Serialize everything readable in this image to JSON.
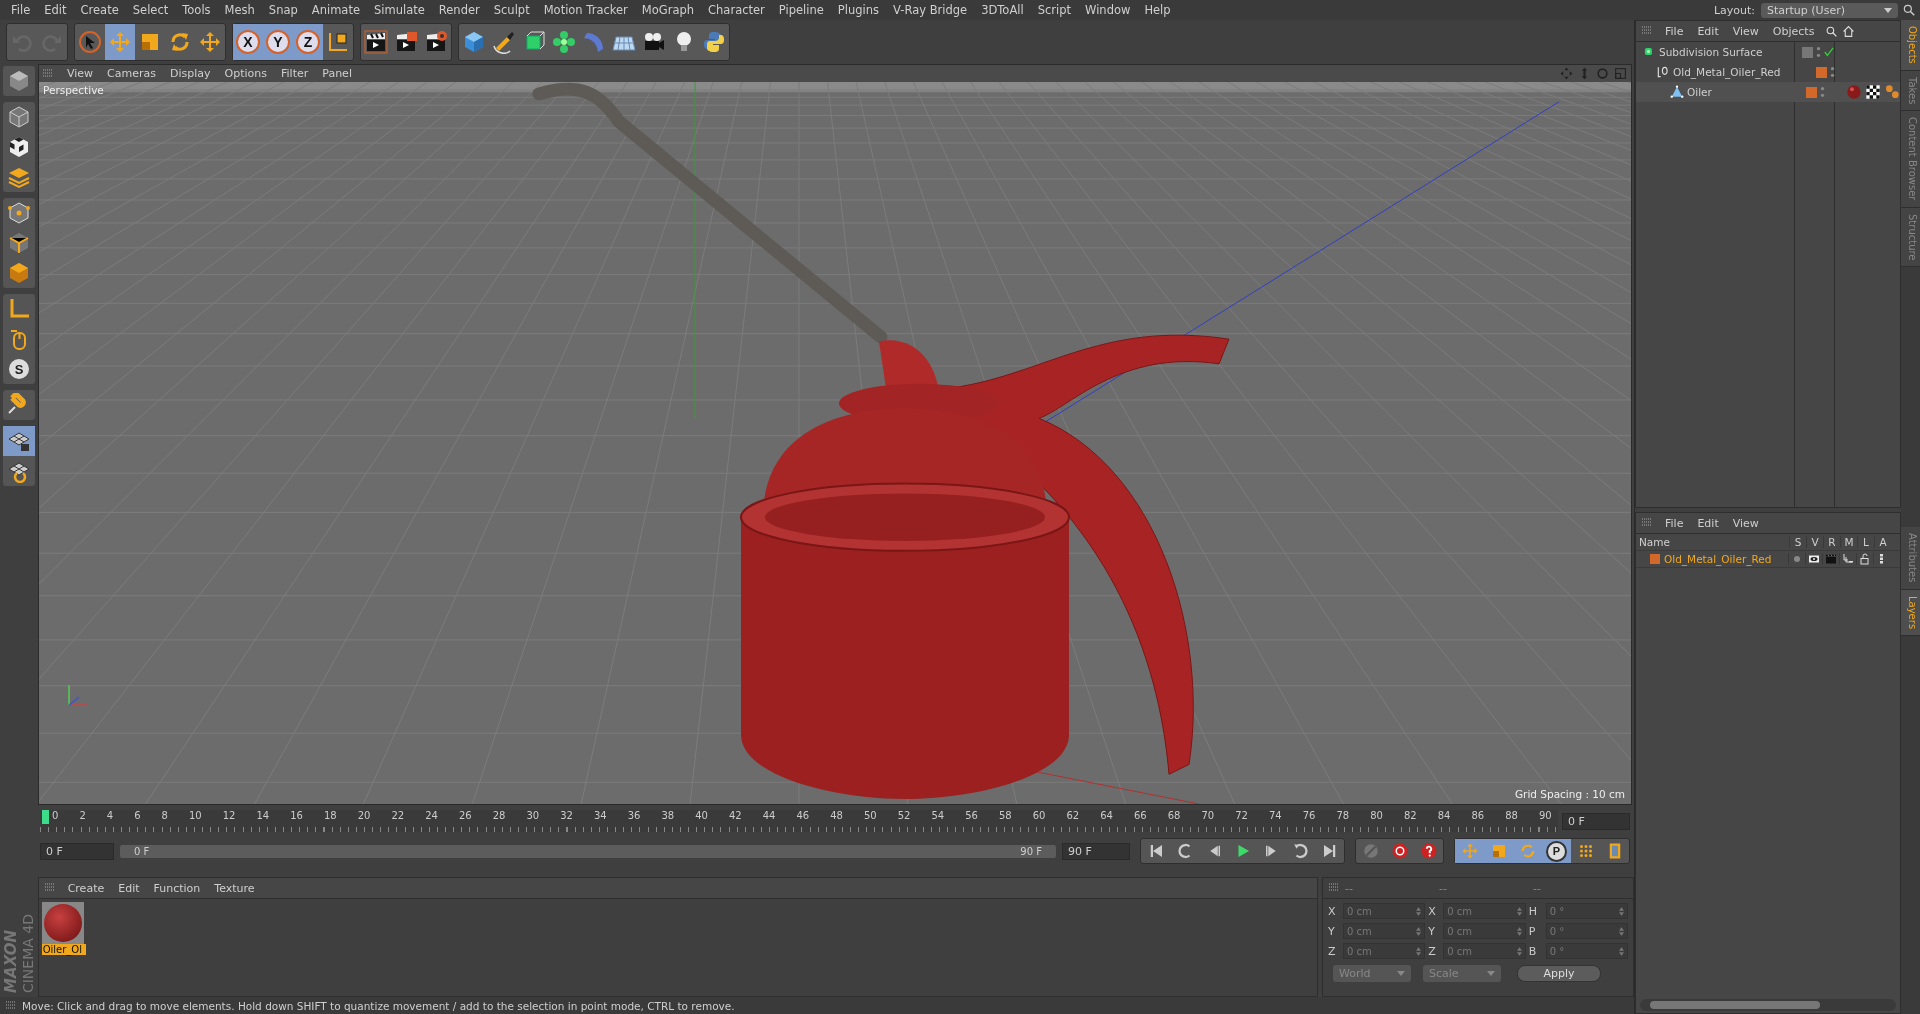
{
  "menu_bar": [
    "File",
    "Edit",
    "Create",
    "Select",
    "Tools",
    "Mesh",
    "Snap",
    "Animate",
    "Simulate",
    "Render",
    "Sculpt",
    "Motion Tracker",
    "MoGraph",
    "Character",
    "Pipeline",
    "Plugins",
    "V-Ray Bridge",
    "3DToAll",
    "Script",
    "Window",
    "Help"
  ],
  "layout": {
    "label": "Layout:",
    "value": "Startup (User)"
  },
  "toolbar": [
    [
      {
        "kind": "undo",
        "selected": false,
        "disabled": true
      },
      {
        "kind": "redo",
        "selected": false,
        "disabled": true
      }
    ],
    [
      {
        "kind": "select",
        "selected": false,
        "disabled": false
      },
      {
        "kind": "move",
        "selected": true,
        "disabled": false
      },
      {
        "kind": "scale",
        "selected": false,
        "disabled": false
      },
      {
        "kind": "rotate",
        "selected": false,
        "disabled": false
      },
      {
        "kind": "transform",
        "selected": false,
        "disabled": false
      }
    ],
    [
      {
        "kind": "axis",
        "label": "X",
        "selected": true,
        "disabled": false
      },
      {
        "kind": "axis",
        "label": "Y",
        "selected": true,
        "disabled": false
      },
      {
        "kind": "axis",
        "label": "Z",
        "selected": true,
        "disabled": false
      },
      {
        "kind": "coords",
        "selected": false,
        "disabled": false
      }
    ],
    [
      {
        "kind": "render-view",
        "selected": false,
        "disabled": false
      },
      {
        "kind": "render-picture",
        "selected": false,
        "disabled": false
      },
      {
        "kind": "render-settings",
        "selected": false,
        "disabled": false
      }
    ],
    [
      {
        "kind": "cube",
        "selected": false,
        "disabled": false
      },
      {
        "kind": "pen",
        "selected": false,
        "disabled": false
      },
      {
        "kind": "subdivision",
        "selected": false,
        "disabled": false
      },
      {
        "kind": "cloner",
        "selected": false,
        "disabled": false
      },
      {
        "kind": "deformer",
        "selected": false,
        "disabled": false
      },
      {
        "kind": "floor",
        "selected": false,
        "disabled": false
      },
      {
        "kind": "camera",
        "selected": false,
        "disabled": false
      },
      {
        "kind": "light",
        "selected": false,
        "disabled": false
      },
      {
        "kind": "python",
        "selected": false,
        "disabled": false
      }
    ]
  ],
  "left_tools": [
    [
      {
        "kind": "make-editable",
        "selected": false
      }
    ],
    [
      {
        "kind": "model",
        "selected": false
      },
      {
        "kind": "texture",
        "selected": false
      },
      {
        "kind": "workplane",
        "selected": false
      }
    ],
    [
      {
        "kind": "points",
        "selected": false
      },
      {
        "kind": "edges",
        "selected": false
      },
      {
        "kind": "polygons",
        "selected": false
      }
    ],
    [
      {
        "kind": "axis",
        "selected": false
      },
      {
        "kind": "tweak",
        "selected": false
      },
      {
        "kind": "snap",
        "label": "S",
        "selected": false
      }
    ],
    [
      {
        "kind": "magnet",
        "selected": false
      }
    ],
    [
      {
        "kind": "grid-lock",
        "selected": true
      },
      {
        "kind": "grid-lock-2",
        "selected": false
      }
    ]
  ],
  "viewport": {
    "menu": [
      "View",
      "Cameras",
      "Display",
      "Options",
      "Filter",
      "Panel"
    ],
    "camera": "Perspective",
    "grid_spacing": "Grid Spacing : 10 cm"
  },
  "timeline": {
    "frames": [
      "0",
      "2",
      "4",
      "6",
      "8",
      "10",
      "12",
      "14",
      "16",
      "18",
      "20",
      "22",
      "24",
      "26",
      "28",
      "30",
      "32",
      "34",
      "36",
      "38",
      "40",
      "42",
      "44",
      "46",
      "48",
      "50",
      "52",
      "54",
      "56",
      "58",
      "60",
      "62",
      "64",
      "66",
      "68",
      "70",
      "72",
      "74",
      "76",
      "78",
      "80",
      "82",
      "84",
      "86",
      "88",
      "90"
    ],
    "current_frame": "0 F",
    "start_field": "0 F",
    "range_start": "0 F",
    "range_slider": {
      "level": 1
    },
    "range_end": "90 F",
    "end_field": "90 F",
    "playback": [
      {
        "kind": "to-start"
      },
      {
        "kind": "prev-key"
      },
      {
        "kind": "prev-frame"
      },
      {
        "kind": "play"
      },
      {
        "kind": "next-frame"
      },
      {
        "kind": "next-key"
      },
      {
        "kind": "to-end"
      }
    ],
    "record": [
      {
        "kind": "record-position"
      },
      {
        "kind": "autokey"
      },
      {
        "kind": "help"
      }
    ],
    "key_modes": [
      {
        "kind": "move",
        "selected": true
      },
      {
        "kind": "scale",
        "selected": true
      },
      {
        "kind": "rotate",
        "selected": true
      },
      {
        "kind": "param",
        "label": "P",
        "selected": true
      },
      {
        "kind": "point-level",
        "selected": false
      },
      {
        "kind": "timeline",
        "selected": false
      }
    ]
  },
  "material_manager": {
    "menu": [
      "Create",
      "Edit",
      "Function",
      "Texture"
    ],
    "materials": [
      {
        "name": "Oiler_Ol",
        "selected": true
      }
    ]
  },
  "coordinates": {
    "headers": [
      "--",
      "--",
      "--"
    ],
    "rows": [
      [
        {
          "axis": "X",
          "value": "0 cm"
        },
        {
          "axis": "X",
          "value": "0 cm"
        },
        {
          "axis": "H",
          "value": "0 °"
        }
      ],
      [
        {
          "axis": "Y",
          "value": "0 cm"
        },
        {
          "axis": "Y",
          "value": "0 cm"
        },
        {
          "axis": "P",
          "value": "0 °"
        }
      ],
      [
        {
          "axis": "Z",
          "value": "0 cm"
        },
        {
          "axis": "Z",
          "value": "0 cm"
        },
        {
          "axis": "B",
          "value": "0 °"
        }
      ]
    ],
    "dropdowns": [
      "World",
      "Scale"
    ],
    "apply": "Apply"
  },
  "logo": {
    "brand": "MAXON",
    "product": "CINEMA 4D"
  },
  "status_bar": "Move: Click and drag to move elements. Hold down SHIFT to quantize movement / add to the selection in point mode, CTRL to remove.",
  "object_manager": {
    "menu": [
      "File",
      "Edit",
      "View",
      "Objects"
    ],
    "objects": [
      {
        "name": "Subdivision Surface",
        "kind": "subdivision",
        "enabled": true,
        "children": [
          {
            "name": "Old_Metal_Oiler_Red",
            "kind": "null",
            "color": "#d2692a",
            "children": [
              {
                "name": "Oiler",
                "kind": "polygon",
                "color": "#d2692a",
                "tags": [
                  {
                    "kind": "material"
                  },
                  {
                    "kind": "texture"
                  },
                  {
                    "kind": "phong"
                  }
                ]
              }
            ]
          }
        ]
      }
    ]
  },
  "layer_manager": {
    "menu": [
      "File",
      "Edit",
      "View"
    ],
    "columns": [
      "Name",
      "S",
      "V",
      "R",
      "M",
      "L",
      "A"
    ],
    "layers": [
      {
        "name": "Old_Metal_Oiler_Red",
        "color": "#d2692a"
      }
    ]
  },
  "side_tabs_top": [
    {
      "label": "Objects",
      "selected": true
    },
    {
      "label": "Takes",
      "selected": false
    },
    {
      "label": "Content Browser",
      "selected": false
    },
    {
      "label": "Structure",
      "selected": false
    }
  ],
  "side_tabs_bottom": [
    {
      "label": "Attributes",
      "selected": false
    },
    {
      "label": "Layers",
      "selected": true
    }
  ]
}
